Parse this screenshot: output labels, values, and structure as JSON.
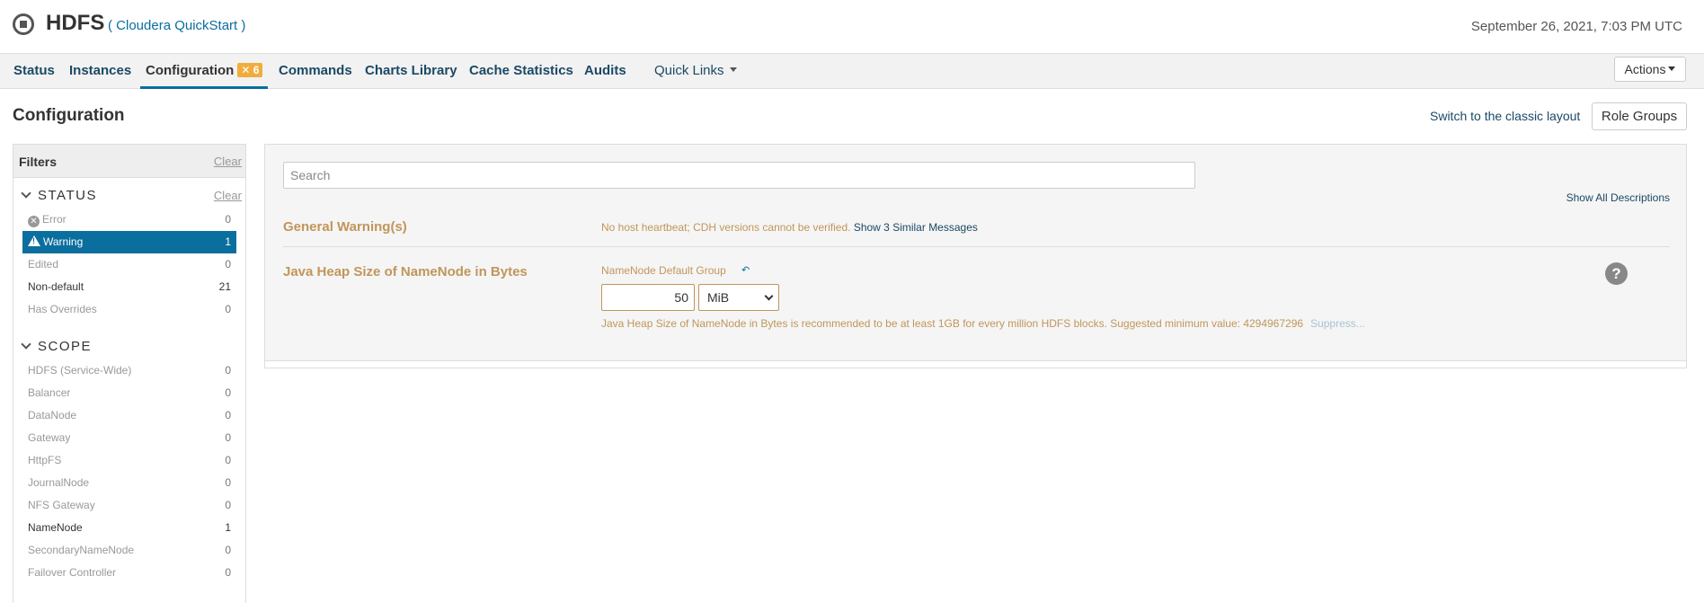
{
  "header": {
    "service_name": "HDFS",
    "cluster": "( Cloudera QuickStart )",
    "datetime": "September 26, 2021, 7:03 PM UTC",
    "service_icon": "service-status-icon"
  },
  "tabs": {
    "status": "Status",
    "instances": "Instances",
    "configuration": "Configuration",
    "configuration_badge": "6",
    "commands": "Commands",
    "charts_library": "Charts Library",
    "cache_statistics": "Cache Statistics",
    "audits": "Audits",
    "quick_links": "Quick Links",
    "actions": "Actions"
  },
  "page": {
    "title": "Configuration",
    "classic_link": "Switch to the classic layout",
    "role_groups": "Role Groups"
  },
  "filters": {
    "title": "Filters",
    "clear": "Clear",
    "status": {
      "title": "STATUS",
      "clear": "Clear",
      "items": [
        {
          "label": "Error",
          "count": "0"
        },
        {
          "label": "Warning",
          "count": "1"
        },
        {
          "label": "Edited",
          "count": "0"
        },
        {
          "label": "Non-default",
          "count": "21"
        },
        {
          "label": "Has Overrides",
          "count": "0"
        }
      ]
    },
    "scope": {
      "title": "SCOPE",
      "items": [
        {
          "label": "HDFS (Service-Wide)",
          "count": "0"
        },
        {
          "label": "Balancer",
          "count": "0"
        },
        {
          "label": "DataNode",
          "count": "0"
        },
        {
          "label": "Gateway",
          "count": "0"
        },
        {
          "label": "HttpFS",
          "count": "0"
        },
        {
          "label": "JournalNode",
          "count": "0"
        },
        {
          "label": "NFS Gateway",
          "count": "0"
        },
        {
          "label": "NameNode",
          "count": "1"
        },
        {
          "label": "SecondaryNameNode",
          "count": "0"
        },
        {
          "label": "Failover Controller",
          "count": "0"
        }
      ]
    }
  },
  "main": {
    "search_placeholder": "Search",
    "show_all_descriptions": "Show All Descriptions",
    "general_warning": {
      "title": "General Warning(s)",
      "message": "No host heartbeat; CDH versions cannot be verified.",
      "link": "Show 3 Similar Messages"
    },
    "java_heap": {
      "title": "Java Heap Size of NameNode in Bytes",
      "group": "NameNode Default Group",
      "value": "50",
      "unit": "MiB",
      "recommendation": "Java Heap Size of NameNode in Bytes is recommended to be at least 1GB for every million HDFS blocks. Suggested minimum value: 4294967296",
      "suppress": "Suppress..."
    }
  }
}
